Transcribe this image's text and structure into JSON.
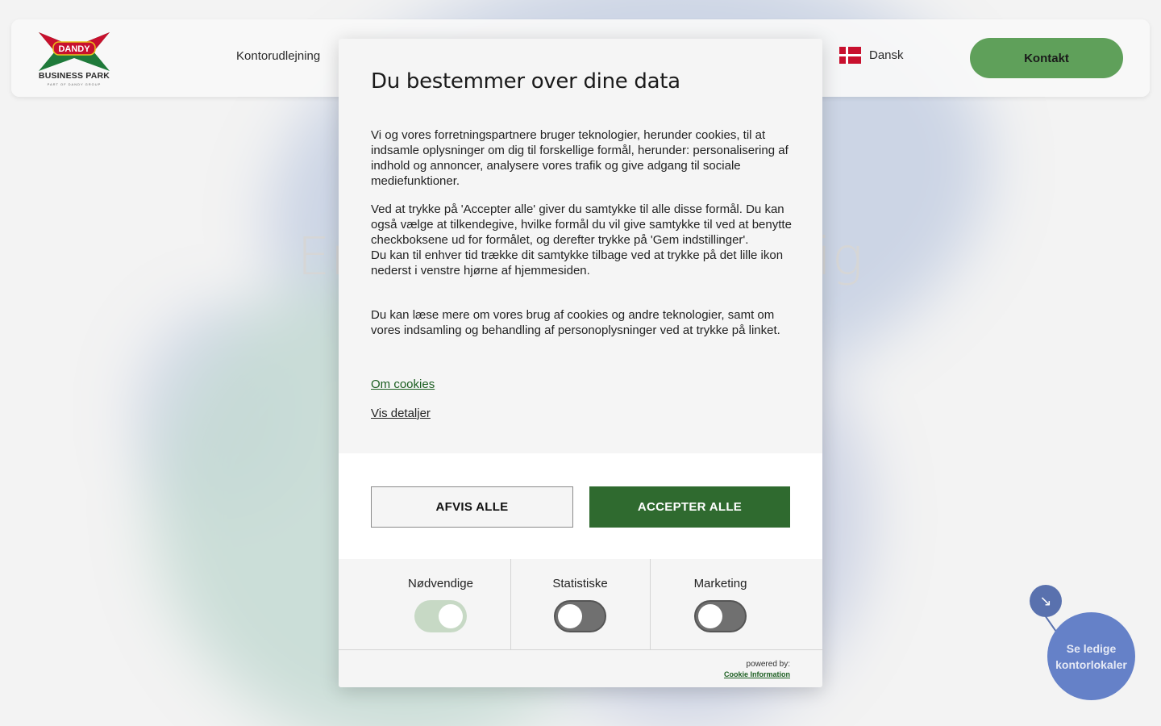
{
  "header": {
    "logo_top": "DANDY",
    "logo_name": "BUSINESS PARK",
    "logo_sub": "PART OF DANDY GROUP",
    "nav": [
      "Kontorudlejning"
    ],
    "language": "Dansk",
    "contact_label": "Kontakt"
  },
  "hero": {
    "title_left": "En",
    "title_right": "dig"
  },
  "floating": {
    "arrow": "↘",
    "label": "Se ledige kontorlokaler"
  },
  "dialog": {
    "title": "Du bestemmer over dine data",
    "paragraph1": "Vi og vores forretningspartnere bruger teknologier, herunder cookies, til at indsamle oplysninger om dig til forskellige formål, herunder: personalisering af indhold og annoncer, analysere vores trafik og give adgang til sociale mediefunktioner.",
    "paragraph2a": "Ved at trykke på 'Accepter alle' giver du samtykke til alle disse formål. Du kan også vælge at tilkendegive, hvilke formål du vil give samtykke til ved at benytte checkboksene ud for formålet, og derefter trykke på 'Gem indstillinger'.",
    "paragraph2b": "Du kan til enhver tid trække dit samtykke tilbage ved at trykke på det lille ikon nederst i venstre hjørne af hjemmesiden.",
    "paragraph3": "Du kan læse mere om vores brug af cookies og andre teknologier, samt om vores indsamling og behandling af personoplysninger ved at trykke på linket.",
    "link_cookies": "Om cookies",
    "link_details": "Vis detaljer",
    "reject_label": "AFVIS ALLE",
    "accept_label": "ACCEPTER ALLE",
    "categories": [
      {
        "label": "Nødvendige",
        "enabled": true
      },
      {
        "label": "Statistiske",
        "enabled": false
      },
      {
        "label": "Marketing",
        "enabled": false
      }
    ],
    "powered_by": "powered by:",
    "powered_link": "Cookie Information"
  },
  "colors": {
    "accent_green": "#2f6a2f",
    "contact_green": "#5fa05a",
    "blue": "#2e55b8",
    "flag_red": "#c8102e"
  }
}
